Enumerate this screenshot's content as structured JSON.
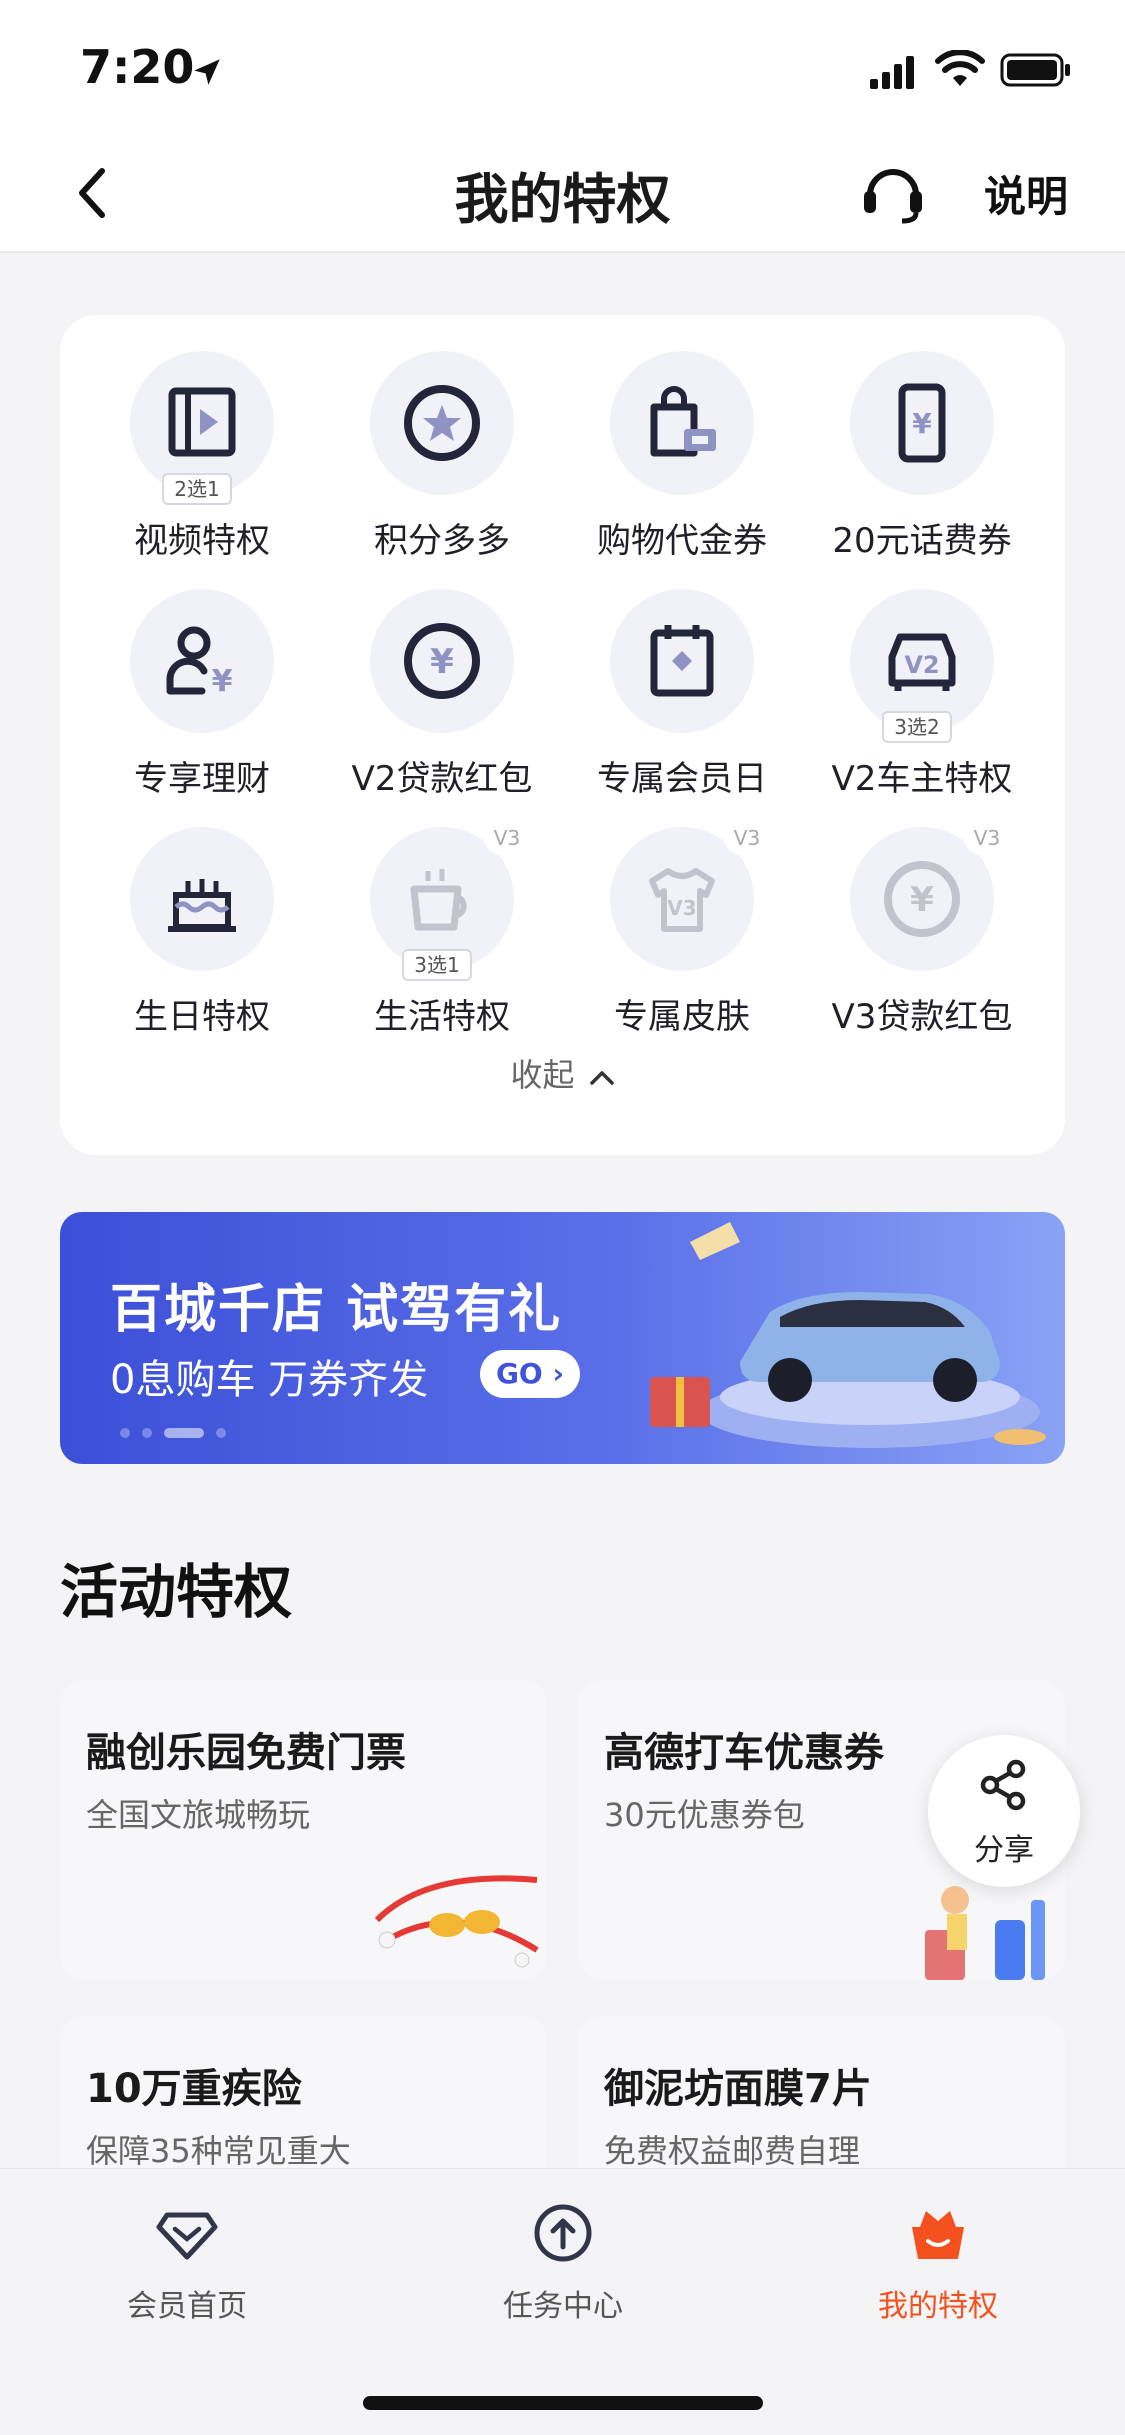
{
  "status_bar": {
    "time": "7:20"
  },
  "nav": {
    "title": "我的特权",
    "help_label": "说明"
  },
  "privileges": [
    {
      "label": "视频特权",
      "tag": "2选1",
      "level": "",
      "icon": "video-icon",
      "locked": false
    },
    {
      "label": "积分多多",
      "tag": "",
      "level": "",
      "icon": "star-coin-icon",
      "locked": false
    },
    {
      "label": "购物代金券",
      "tag": "",
      "level": "",
      "icon": "shopping-bag-icon",
      "locked": false
    },
    {
      "label": "20元话费券",
      "tag": "",
      "level": "",
      "icon": "phone-icon",
      "locked": false
    },
    {
      "label": "专享理财",
      "tag": "",
      "level": "",
      "icon": "finance-user-icon",
      "locked": false
    },
    {
      "label": "V2贷款红包",
      "tag": "",
      "level": "",
      "icon": "yen-coin-icon",
      "locked": false
    },
    {
      "label": "专属会员日",
      "tag": "",
      "level": "",
      "icon": "calendar-icon",
      "locked": false
    },
    {
      "label": "V2车主特权",
      "tag": "3选2",
      "level": "",
      "icon": "car-v2-icon",
      "locked": false
    },
    {
      "label": "生日特权",
      "tag": "",
      "level": "",
      "icon": "cake-icon",
      "locked": false
    },
    {
      "label": "生活特权",
      "tag": "3选1",
      "level": "V3",
      "icon": "coffee-cup-icon",
      "locked": true
    },
    {
      "label": "专属皮肤",
      "tag": "",
      "level": "V3",
      "icon": "tshirt-icon",
      "locked": true
    },
    {
      "label": "V3贷款红包",
      "tag": "",
      "level": "V3",
      "icon": "yen-coin-icon",
      "locked": true
    }
  ],
  "collapse_label": "收起",
  "banner": {
    "title": "百城千店 试驾有礼",
    "subtitle": "0息购车 万券齐发",
    "go_label": "GO",
    "page_count": 4,
    "active_page": 3
  },
  "activities": {
    "title": "活动特权",
    "cards": [
      {
        "title": "融创乐园免费门票",
        "subtitle": "全国文旅城畅玩"
      },
      {
        "title": "高德打车优惠券",
        "subtitle": "30元优惠券包"
      },
      {
        "title": "10万重疾险",
        "subtitle": "保障35种常见重大"
      },
      {
        "title": "御泥坊面膜7片",
        "subtitle": "免费权益邮费自理"
      }
    ]
  },
  "share_label": "分享",
  "tabs": [
    {
      "label": "会员首页",
      "icon": "diamond-icon",
      "active": false
    },
    {
      "label": "任务中心",
      "icon": "upload-circle-icon",
      "active": false
    },
    {
      "label": "我的特权",
      "icon": "crown-basket-icon",
      "active": true
    }
  ],
  "colors": {
    "accent": "#f4511e",
    "icon_dark": "#23253a",
    "icon_locked": "#b9bbc5",
    "banner": "#4457dc"
  }
}
